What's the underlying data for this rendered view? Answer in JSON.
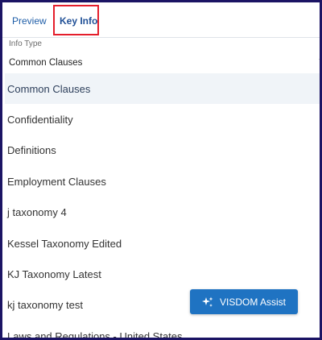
{
  "tabs": [
    {
      "label": "Preview"
    },
    {
      "label": "Key Info"
    }
  ],
  "info_type": {
    "label": "Info Type",
    "selected": "Common Clauses"
  },
  "options": [
    {
      "label": "Common Clauses"
    },
    {
      "label": "Confidentiality"
    },
    {
      "label": "Definitions"
    },
    {
      "label": "Employment Clauses"
    },
    {
      "label": "j taxonomy 4"
    },
    {
      "label": "Kessel Taxonomy Edited"
    },
    {
      "label": "KJ Taxonomy Latest"
    },
    {
      "label": "kj taxonomy test"
    },
    {
      "label": "Laws and Regulations - United States"
    }
  ],
  "assist_button": {
    "label": "VISDOM Assist",
    "icon": "sparkle-icon"
  },
  "colors": {
    "frame_border": "#1b1464",
    "highlight_box": "#e41e2b",
    "accent": "#1f73c2",
    "selected_row": "#f0f4f8"
  }
}
